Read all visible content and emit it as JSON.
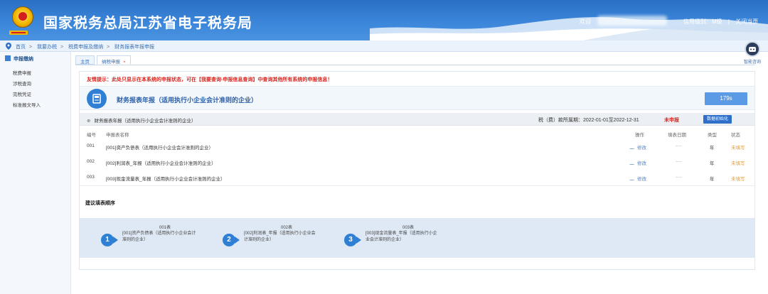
{
  "header": {
    "title": "国家税务总局江苏省电子税务局",
    "welcome": "欢迎",
    "links": [
      "信用级别：M级",
      "|",
      "关闭当页"
    ]
  },
  "breadcrumb": [
    "首页",
    "我要办税",
    "税费申报及缴纳",
    "财务报表年报申报"
  ],
  "sidebar": {
    "heading": "申报缴纳",
    "items": [
      "税费申报",
      "涉税查询",
      "完税凭证",
      "标准报文导入"
    ]
  },
  "tabs": [
    {
      "label": "主页",
      "closable": false,
      "active": false
    },
    {
      "label": "纳税申报",
      "closable": true,
      "active": true
    }
  ],
  "tab_close_glyph": "×",
  "assistant": {
    "label": "智能咨询",
    "icon": "robot-icon"
  },
  "main": {
    "notice": "友情提示：此处只显示在本系统的申报状态，可在【我要查询-申报信息查询】中查询其他所有系统的申报信息！",
    "form_title": "财务报表年报（适用执行小企业会计准则的企业）",
    "timer": "179s",
    "section_name": "财务报表年报（适用执行小企业会计准则的企业）",
    "section_marker": "⊕",
    "period": "税（费）款所属期：2022-01-01至2022-12-31",
    "report_status": "未申报",
    "init_button": "数据初始化",
    "columns": [
      "编号",
      "申报表名称",
      "操作",
      "填表日期",
      "类型",
      "状态"
    ],
    "rows": [
      {
        "no": "001",
        "name": "[001]资产负债表（适用执行小企业会计准则的企业）",
        "op": "修改",
        "date": "----",
        "type": "年",
        "status": "未填写"
      },
      {
        "no": "002",
        "name": "[002]利润表_年报（适用执行小企业会计准则的企业）",
        "op": "修改",
        "date": "----",
        "type": "年",
        "status": "未填写"
      },
      {
        "no": "003",
        "name": "[003]现金流量表_年报（适用执行小企业会计准则的企业）",
        "op": "修改",
        "date": "----",
        "type": "年",
        "status": "未填写"
      }
    ],
    "suggest_title": "建议填表顺序",
    "steps": [
      {
        "num": "1",
        "code": "001表",
        "text": "[001]资产负债表（适用执行小企业会计准则的企业）"
      },
      {
        "num": "2",
        "code": "002表",
        "text": "[002]利润表_年报（适用执行小企业会计准则的企业）"
      },
      {
        "num": "3",
        "code": "003表",
        "text": "[003]现金流量表_年报（适用执行小企业会计准则的企业）"
      }
    ]
  },
  "colors": {
    "header_blue": "#3b86da",
    "accent_blue": "#2f7fd4",
    "alert_red": "#d9221c",
    "status_orange": "#f09a1d"
  }
}
